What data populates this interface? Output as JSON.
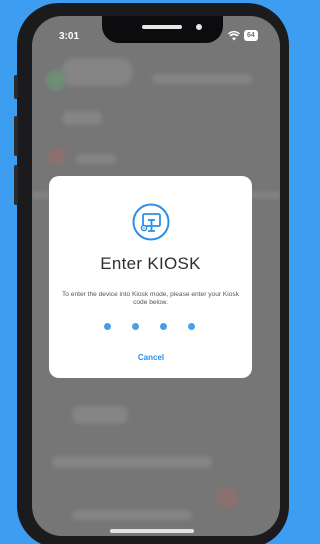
{
  "status_bar": {
    "time": "3:01",
    "battery": "64"
  },
  "dialog": {
    "icon": "kiosk-monitor-icon",
    "title": "Enter KIOSK",
    "description": "To enter the device into Kiosk mode, please enter your Kiosk code below.",
    "pin_length": 4,
    "cancel_label": "Cancel"
  },
  "colors": {
    "background": "#3d9df0",
    "accent": "#2e8ee6",
    "pin_dot": "#4a9ee9",
    "overlay": "#767676"
  }
}
